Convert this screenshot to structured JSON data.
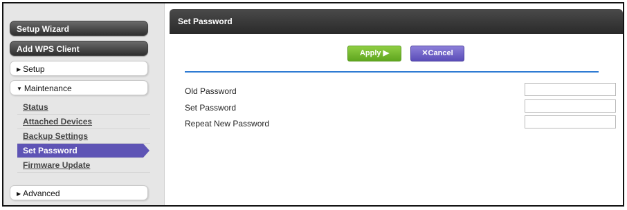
{
  "sidebar": {
    "setup_wizard": "Setup Wizard",
    "add_wps_client": "Add WPS Client",
    "setup": "Setup",
    "maintenance": "Maintenance",
    "maintenance_items": [
      "Status",
      "Attached Devices",
      "Backup Settings",
      "Set Password",
      "Firmware Update"
    ],
    "active_item": "Set Password",
    "advanced": "Advanced",
    "collapsed_arrow": "▶",
    "expanded_arrow": "▼"
  },
  "main": {
    "title": "Set Password",
    "apply_label": "Apply ▶",
    "cancel_label": "✕Cancel",
    "fields": [
      {
        "label": "Old Password",
        "value": ""
      },
      {
        "label": "Set Password",
        "value": ""
      },
      {
        "label": "Repeat New Password",
        "value": ""
      }
    ]
  },
  "colors": {
    "accent_purple": "#5e54b5",
    "apply_green": "#6fb52a",
    "rule_blue": "#2f7bd3",
    "header_dark": "#333333"
  }
}
